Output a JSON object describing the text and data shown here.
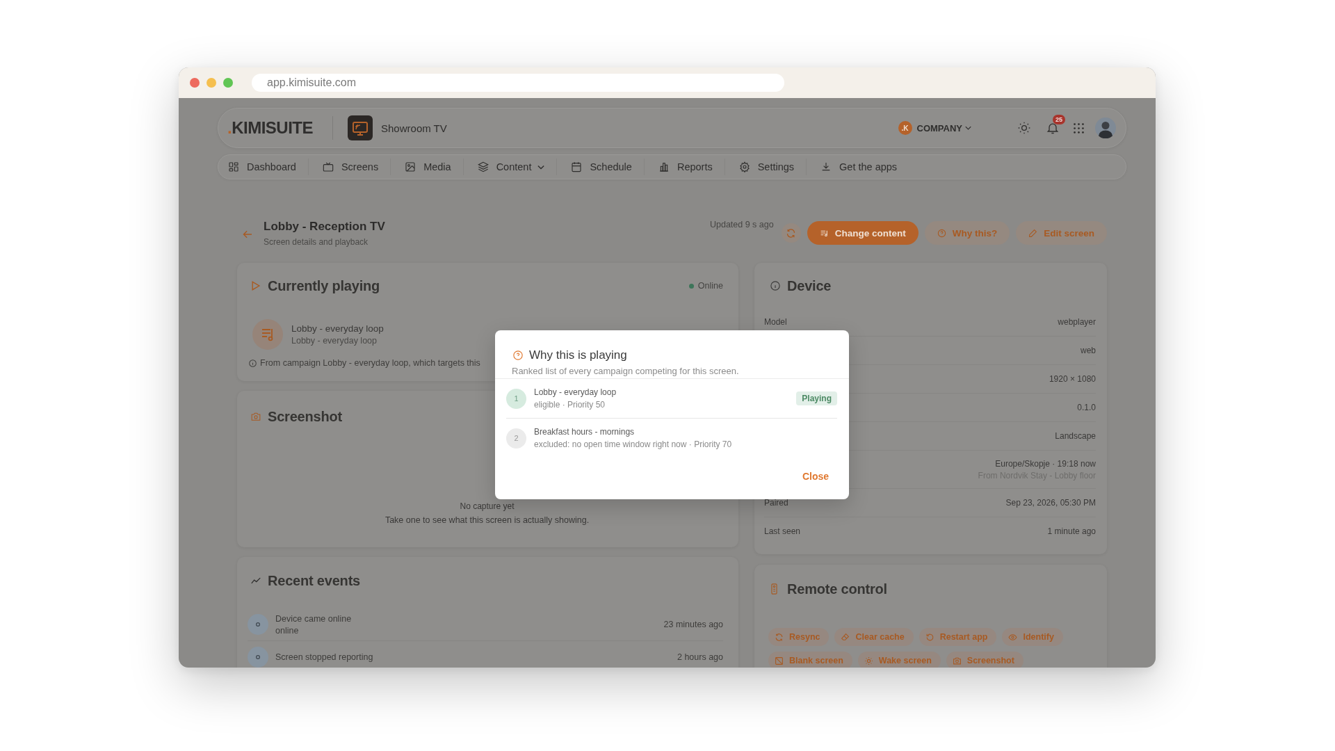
{
  "browser": {
    "url": "app.kimisuite.com"
  },
  "header": {
    "logo_mark": ".",
    "logo_text": "KIMISUITE",
    "screen_name": "Showroom TV",
    "company_initial": ".K",
    "company_name": "COMPANY",
    "notification_count": "25"
  },
  "nav": [
    {
      "label": "Dashboard",
      "selected": false,
      "has_menu": false
    },
    {
      "label": "Screens",
      "selected": false,
      "has_menu": false
    },
    {
      "label": "Media",
      "selected": false,
      "has_menu": false
    },
    {
      "label": "Content",
      "selected": false,
      "has_menu": true
    },
    {
      "label": "Schedule",
      "selected": false,
      "has_menu": false
    },
    {
      "label": "Reports",
      "selected": false,
      "has_menu": false
    },
    {
      "label": "Settings",
      "selected": false,
      "has_menu": false
    },
    {
      "label": "Get the apps",
      "selected": false,
      "has_menu": false
    }
  ],
  "page": {
    "title": "Lobby - Reception TV",
    "subtitle": "Screen details and playback",
    "updated": "Updated 9 s ago",
    "actions": [
      {
        "label": "Change content",
        "kind": "primary"
      },
      {
        "label": "Why this?",
        "kind": "soft"
      },
      {
        "label": "Edit screen",
        "kind": "soft"
      }
    ]
  },
  "now_playing": {
    "title": "Currently playing",
    "status": "Online",
    "item": {
      "title": "Lobby - everyday loop",
      "subtitle": "Lobby - everyday loop"
    },
    "note": "From campaign Lobby - everyday loop, which targets this"
  },
  "screenshot": {
    "title": "Screenshot",
    "empty_title": "No capture yet",
    "empty_hint": "Take one to see what this screen is actually showing."
  },
  "recent_events": {
    "title": "Recent events",
    "events": [
      {
        "title": "Device came online",
        "detail": "online",
        "time": "23 minutes ago"
      },
      {
        "title": "Screen stopped reporting",
        "time": "2 hours ago"
      }
    ]
  },
  "device": {
    "title": "Device",
    "rows": [
      {
        "label": "Model",
        "value": "webplayer"
      },
      {
        "value": "web"
      },
      {
        "value": "1920 × 1080"
      },
      {
        "value": "0.1.0"
      },
      {
        "value": "Landscape"
      },
      {
        "value": "Europe/Skopje · 19:18 now",
        "note": "From Nordvik Stay - Lobby floor"
      },
      {
        "label": "Paired",
        "value": "Sep 23, 2026, 05:30 PM"
      },
      {
        "label": "Last seen",
        "value": "1 minute ago"
      }
    ]
  },
  "remote_control": {
    "title": "Remote control",
    "actions": [
      "Resync",
      "Clear cache",
      "Restart app",
      "Identify",
      "Blank screen",
      "Wake screen",
      "Screenshot"
    ]
  },
  "modal": {
    "title": "Why this is playing",
    "subtitle": "Ranked list of every campaign competing for this screen.",
    "campaigns": [
      {
        "rank": "1",
        "name": "Lobby - everyday loop",
        "detail": "eligible · Priority 50",
        "eligible": true,
        "badge": "Playing"
      },
      {
        "rank": "2",
        "name": "Breakfast hours - mornings",
        "detail": "excluded: no open time window right now · Priority 70",
        "eligible": false
      }
    ],
    "close": "Close"
  }
}
